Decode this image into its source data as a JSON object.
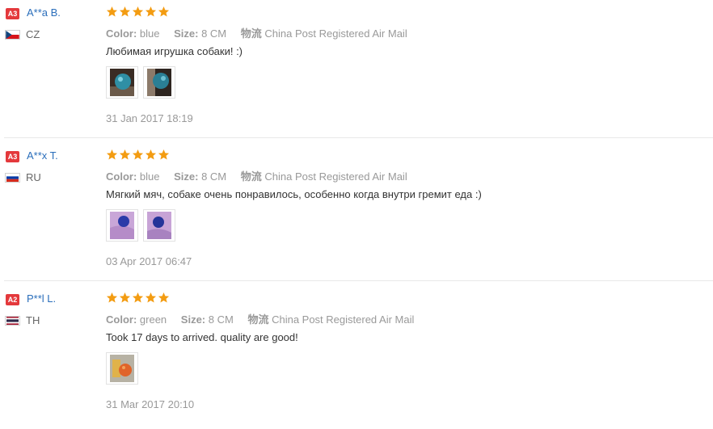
{
  "colors": {
    "level_badge": "#e4393c",
    "star": "#f39c12",
    "username": "#2a6ebb",
    "muted": "#999999"
  },
  "reviews": [
    {
      "level": "A3",
      "user": "A**a B.",
      "country": "CZ",
      "flag": "czech-flag",
      "rating": 5,
      "color_label": "Color:",
      "color_value": "blue",
      "size_label": "Size:",
      "size_value": "8 CM",
      "shipping_label": "物流",
      "shipping_value": "China Post Registered Air Mail",
      "text": "Любимая игрушка собаки! :)",
      "photos": 2,
      "date": "31 Jan 2017 18:19"
    },
    {
      "level": "A3",
      "user": "A**x T.",
      "country": "RU",
      "flag": "russia-flag",
      "rating": 5,
      "color_label": "Color:",
      "color_value": "blue",
      "size_label": "Size:",
      "size_value": "8 CM",
      "shipping_label": "物流",
      "shipping_value": "China Post Registered Air Mail",
      "text": "Мягкий мяч, собаке очень понравилось, особенно когда внутри гремит еда :)",
      "photos": 2,
      "date": "03 Apr 2017 06:47"
    },
    {
      "level": "A2",
      "user": "P**l L.",
      "country": "TH",
      "flag": "thailand-flag",
      "rating": 5,
      "color_label": "Color:",
      "color_value": "green",
      "size_label": "Size:",
      "size_value": "8 CM",
      "shipping_label": "物流",
      "shipping_value": "China Post Registered Air Mail",
      "text": "Took 17 days to arrived. quality are good!",
      "photos": 1,
      "date": "31 Mar 2017 20:10"
    }
  ]
}
